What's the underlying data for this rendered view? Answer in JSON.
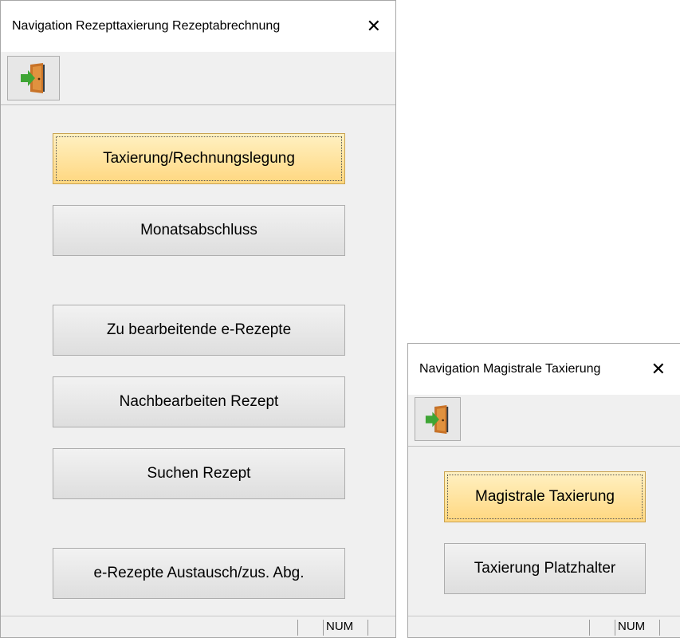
{
  "window1": {
    "title": "Navigation Rezepttaxierung Rezeptabrechnung",
    "close_glyph": "✕",
    "toolbar_icon": "exit-door-icon",
    "buttons": [
      {
        "label": "Taxierung/Rechnungslegung",
        "active": true
      },
      {
        "label": "Monatsabschluss"
      },
      {
        "label": "Zu bearbeitende e-Rezepte"
      },
      {
        "label": "Nachbearbeiten Rezept"
      },
      {
        "label": "Suchen Rezept"
      },
      {
        "label": "e-Rezepte Austausch/zus. Abg."
      }
    ],
    "status": {
      "num": "NUM"
    }
  },
  "window2": {
    "title": "Navigation Magistrale Taxierung",
    "close_glyph": "✕",
    "toolbar_icon": "exit-door-icon",
    "buttons": [
      {
        "label": "Magistrale Taxierung",
        "active": true
      },
      {
        "label": "Taxierung Platzhalter"
      }
    ],
    "status": {
      "num": "NUM"
    }
  },
  "colors": {
    "active_button": "#ffd780",
    "door_frame": "#c87328",
    "arrow": "#3fa535"
  }
}
